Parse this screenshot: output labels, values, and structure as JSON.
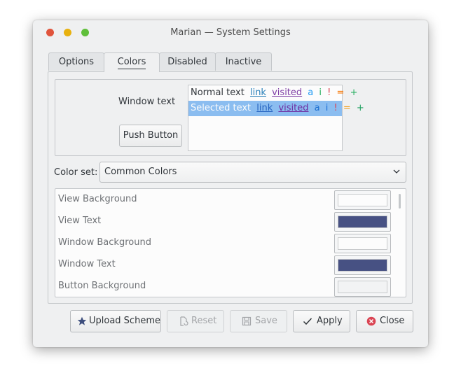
{
  "window": {
    "title": "Marian — System Settings"
  },
  "tabs": [
    {
      "label": "Options"
    },
    {
      "label": "Colors"
    },
    {
      "label": "Disabled"
    },
    {
      "label": "Inactive"
    }
  ],
  "preview": {
    "window_text_label": "Window text",
    "push_button_label": "Push Button",
    "normal_row": {
      "text": "Normal text",
      "link": "link",
      "visited": "visited",
      "a": "a",
      "i": "i",
      "ex": "!",
      "eq": "=",
      "plus": "+"
    },
    "selected_row": {
      "text": "Selected text",
      "link": "link",
      "visited": "visited",
      "a": "a",
      "i": "i",
      "ex": "!",
      "eq": "=",
      "plus": "+"
    }
  },
  "color_set": {
    "label": "Color set:",
    "value": "Common Colors"
  },
  "color_list": [
    {
      "name": "View Background",
      "color": "#fcfcfc"
    },
    {
      "name": "View Text",
      "color": "#475183"
    },
    {
      "name": "Window Background",
      "color": "#fcfcfc"
    },
    {
      "name": "Window Text",
      "color": "#475183"
    },
    {
      "name": "Button Background",
      "color": "#f2f3f4"
    }
  ],
  "buttons": {
    "upload": "Upload Scheme",
    "reset": "Reset",
    "save": "Save",
    "apply": "Apply",
    "close": "Close"
  }
}
